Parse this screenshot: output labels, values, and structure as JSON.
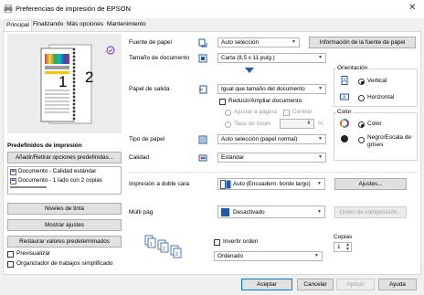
{
  "window": {
    "title": "Preferencias de impresión de EPSON",
    "close": "✕"
  },
  "tabs": [
    "Principal",
    "Finalizando",
    "Más opciones",
    "Mantenimiento"
  ],
  "left": {
    "page_numbers": [
      "1",
      "2"
    ],
    "presets_title": "Predefinidos de impresión",
    "presets_button": "Añadir/Retirar opciones predefinidas...",
    "presets": [
      "Documento - Calidad estándar",
      "Documento - 1 lado con 2 copias"
    ],
    "ink_levels": "Niveles de tinta",
    "show_settings": "Mostrar ajustes",
    "restore_defaults": "Restaurar valores predeterminados",
    "preview": "Previsualizar",
    "job_arranger": "Organizador de trabajos simplificado"
  },
  "main": {
    "paper_source": {
      "label": "Fuente de papel",
      "value": "Auto selección"
    },
    "paper_source_info": "Información de la fuente de papel",
    "document_size": {
      "label": "Tamaño de documento",
      "value": "Carta (8,5 x 11 pulg.)"
    },
    "output_paper": {
      "label": "Papel de salida",
      "value": "Igual que tamaño del documento"
    },
    "reduce_enlarge": "Reducir/Ampliar documento",
    "fit_to_page": "Ajustar a página",
    "center": "Centrar",
    "zoom_to": "Tasa de zoom",
    "zoom_unit": "%",
    "paper_type": {
      "label": "Tipo de papel",
      "value": "Auto selección (papel normal)"
    },
    "quality": {
      "label": "Calidad",
      "value": "Estándar"
    },
    "duplex": {
      "label": "Impresión a doble cara",
      "value": "Auto (Encuadern. borde largo)"
    },
    "duplex_settings": "Ajustes...",
    "multipage": {
      "label": "Múlti pág",
      "value": "Desactivado"
    },
    "page_order": "Orden de composición...",
    "reverse_order": "Invertir orden",
    "collate": "Ordenado",
    "copies": {
      "label": "Copias",
      "value": "1"
    }
  },
  "orientation": {
    "title": "Orientación",
    "portrait": "Vertical",
    "landscape": "Horizontal"
  },
  "color": {
    "title": "Color",
    "color": "Color",
    "grayscale": "Negro/Escala de grises"
  },
  "footer": {
    "ok": "Aceptar",
    "cancel": "Cancelar",
    "apply": "Aplicar",
    "help": "Ayuda"
  }
}
